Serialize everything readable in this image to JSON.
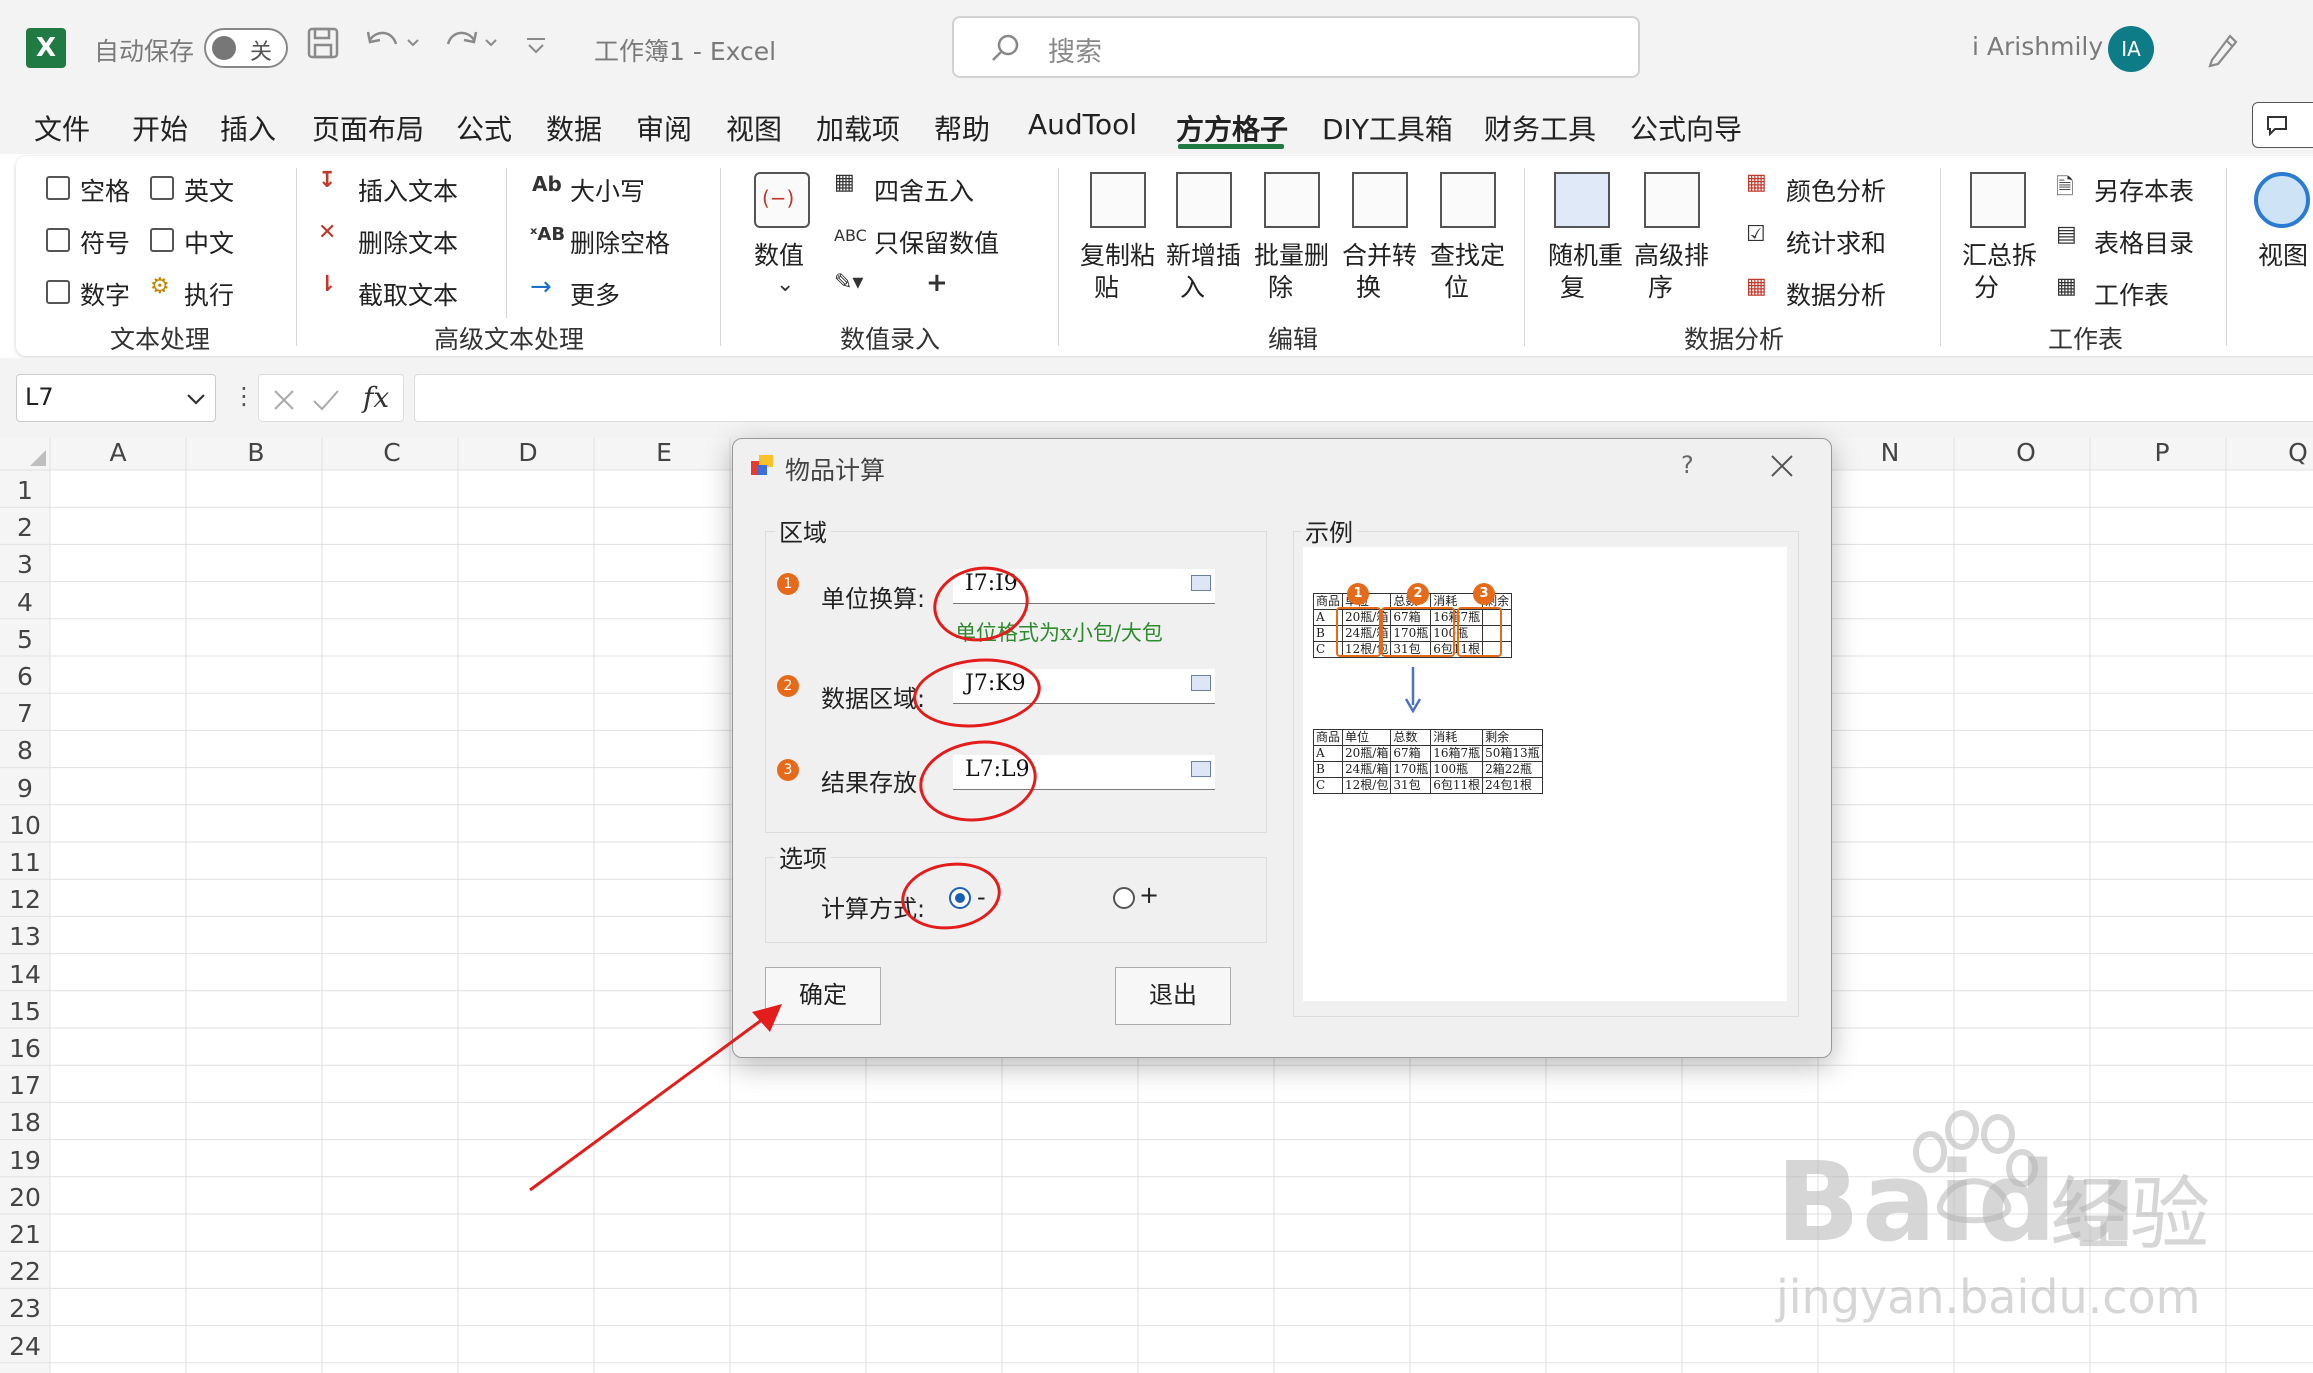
{
  "titlebar": {
    "app_icon": "X",
    "autosave_label": "自动保存",
    "autosave_state": "关",
    "doc_title": "工作簿1  -  Excel",
    "search_placeholder": "搜索",
    "user_name": "i Arishmily",
    "user_initials": "IA"
  },
  "menu": {
    "tabs": [
      "文件",
      "开始",
      "插入",
      "页面布局",
      "公式",
      "数据",
      "审阅",
      "视图",
      "加载项",
      "帮助",
      "AudTool",
      "方方格子",
      "DIY工具箱",
      "财务工具",
      "公式向导"
    ],
    "active_tab": "方方格子"
  },
  "ribbon": {
    "text_processing": {
      "label": "文本处理",
      "checks": [
        "空格",
        "英文",
        "符号",
        "中文",
        "数字"
      ],
      "execute": "执行"
    },
    "advanced_text": {
      "label": "高级文本处理",
      "insert_text": "插入文本",
      "delete_text": "删除文本",
      "extract_text": "截取文本",
      "case": "大小写",
      "delete_spaces": "删除空格",
      "more": "更多"
    },
    "numeric_entry": {
      "label": "数值录入",
      "numeric": "数值",
      "round": "四舍五入",
      "keep_numeric": "只保留数值"
    },
    "edit": {
      "label": "编辑",
      "copy_paste": [
        "复制粘",
        "贴"
      ],
      "add_insert": [
        "新增插",
        "入"
      ],
      "batch_delete": [
        "批量删",
        "除"
      ],
      "merge_convert": [
        "合并转",
        "换"
      ],
      "find_locate": [
        "查找定",
        "位"
      ]
    },
    "data_analysis": {
      "label": "数据分析",
      "random_repeat": [
        "随机重",
        "复"
      ],
      "advanced_sort": [
        "高级排",
        "序"
      ],
      "color_analysis": "颜色分析",
      "stat_sum": "统计求和",
      "data_analysis": "数据分析"
    },
    "worksheet": {
      "label": "工作表",
      "summary_split": [
        "汇总拆",
        "分"
      ],
      "save_sheet": "另存本表",
      "sheet_index": "表格目录",
      "worksheet": "工作表"
    },
    "view": {
      "label": "视图"
    }
  },
  "formula_bar": {
    "name_box": "L7",
    "fx": "fx"
  },
  "sheet": {
    "columns": [
      "A",
      "B",
      "C",
      "D",
      "E",
      "N",
      "O",
      "P",
      "Q"
    ],
    "rows": [
      "1",
      "2",
      "3",
      "4",
      "5",
      "6",
      "7",
      "8",
      "9",
      "10",
      "11",
      "12",
      "13",
      "14",
      "15",
      "16",
      "17",
      "18",
      "19",
      "20",
      "21",
      "22",
      "23",
      "24"
    ]
  },
  "dialog": {
    "title": "物品计算",
    "help": "?",
    "region_label": "区域",
    "unit_convert_label": "单位换算:",
    "unit_convert_value": "I7:I9",
    "unit_hint": "单位格式为x小包/大包",
    "data_region_label": "数据区域:",
    "data_region_value": "J7:K9",
    "result_label": "结果存放:",
    "result_value": "L7:L9",
    "options_label": "选项",
    "calc_mode_label": "计算方式:",
    "minus": "-",
    "plus": "+",
    "ok_button": "确定",
    "exit_button": "退出",
    "example_label": "示例",
    "steps": [
      "1",
      "2",
      "3"
    ]
  },
  "example": {
    "headers": [
      "商品",
      "单位",
      "总数",
      "消耗",
      "剩余"
    ],
    "before": [
      [
        "A",
        "20瓶/箱",
        "67箱",
        "16箱7瓶",
        ""
      ],
      [
        "B",
        "24瓶/箱",
        "170瓶",
        "100瓶",
        ""
      ],
      [
        "C",
        "12根/包",
        "31包",
        "6包11根",
        ""
      ]
    ],
    "after": [
      [
        "A",
        "20瓶/箱",
        "67箱",
        "16箱7瓶",
        "50箱13瓶"
      ],
      [
        "B",
        "24瓶/箱",
        "170瓶",
        "100瓶",
        "2箱22瓶"
      ],
      [
        "C",
        "12根/包",
        "31包",
        "6包11根",
        "24包1根"
      ]
    ],
    "callouts": [
      "1",
      "2",
      "3"
    ]
  },
  "watermark": {
    "brand": "Bai",
    "brand2": "du",
    "cn": "经验",
    "url": "jingyan.baidu.com"
  }
}
